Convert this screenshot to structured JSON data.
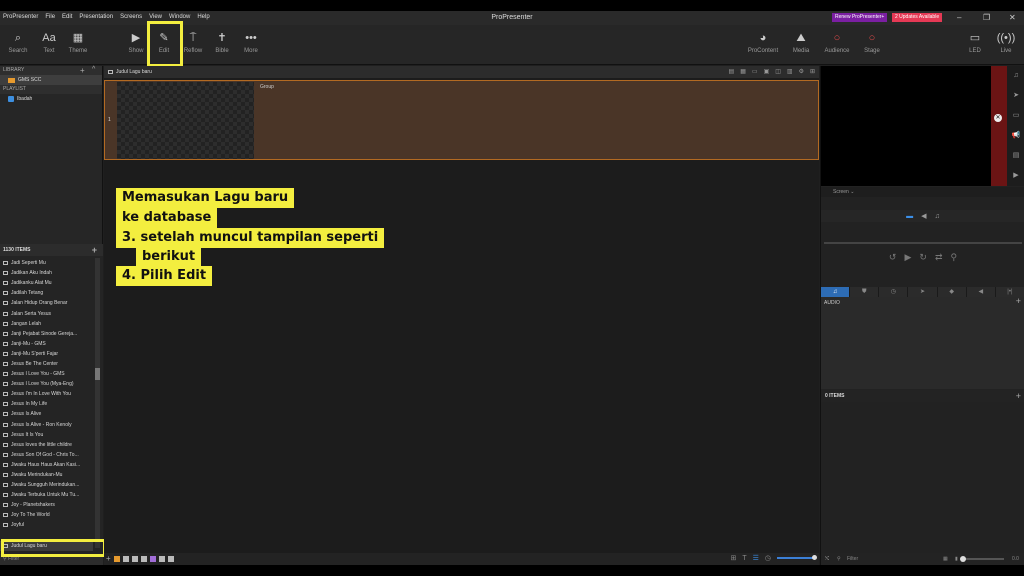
{
  "titlebar": {
    "menu": [
      "ProPresenter",
      "File",
      "Edit",
      "Presentation",
      "Screens",
      "View",
      "Window",
      "Help"
    ],
    "app_title": "ProPresenter",
    "renew_label": "Renew ProPresenter+",
    "updates_label": "2 Updates Available"
  },
  "toolbar": {
    "left": [
      {
        "label": "Search",
        "icon": "search-icon",
        "glyph": "⌕"
      },
      {
        "label": "Text",
        "icon": "text-icon",
        "glyph": "Aa"
      },
      {
        "label": "Theme",
        "icon": "theme-icon",
        "glyph": "▦"
      },
      {
        "label": "Show",
        "icon": "play-icon",
        "glyph": "▶"
      },
      {
        "label": "Edit",
        "icon": "pencil-icon",
        "glyph": "✎"
      },
      {
        "label": "Reflow",
        "icon": "reflow-icon",
        "glyph": "⍑"
      },
      {
        "label": "Bible",
        "icon": "bible-icon",
        "glyph": "✝"
      },
      {
        "label": "More",
        "icon": "more-icon",
        "glyph": "•••"
      }
    ],
    "right": [
      {
        "label": "ProContent",
        "icon": "procontent-icon",
        "glyph": "◕"
      },
      {
        "label": "Media",
        "icon": "media-icon",
        "glyph": "⛰"
      },
      {
        "label": "Audience",
        "icon": "audience-icon",
        "glyph": "○"
      },
      {
        "label": "Stage",
        "icon": "stage-icon",
        "glyph": "○"
      },
      {
        "label": "LED",
        "icon": "led-icon",
        "glyph": "▭"
      },
      {
        "label": "Live",
        "icon": "live-icon",
        "glyph": "((•))"
      }
    ]
  },
  "library": {
    "header": "LIBRARY",
    "items": [
      "GMS SCC"
    ],
    "playlist_header": "PLAYLIST",
    "playlists": [
      "Ibadah"
    ]
  },
  "items_panel": {
    "count_label": "1130 ITEMS",
    "songs": [
      "Jadi Seperti Mu",
      "Jadikan Aku Indah",
      "Jadikanku Alat Mu",
      "Jadilah Tetang",
      "Jalan Hidup Orang Benar",
      "Jalan Serta Yesus",
      "Jangan Lelah",
      "Janji Pejabat Sinode Gereja...",
      "Janji-Mu - GMS",
      "Janji-Mu S'perti Fajar",
      "Jesus Be The Center",
      "Jesus I Love You - GMS",
      "Jesus I Love You (Mya-Eng)",
      "Jesus I'm In Love With You",
      "Jesus In My Life",
      "Jesus Is Alive",
      "Jesus Is Alive - Ron Kenoly",
      "Jesus It Is You",
      "Jesus loves the little childre",
      "Jesus Son Of God - Chris To...",
      "Jiwaku Haus Haus Akan Kasi...",
      "Jiwaku Merindukan-Mu",
      "Jiwaku Sungguh Merindukan...",
      "Jiwaku Terbuka Untuk Mu Tu...",
      "Joy - Planetshakers",
      "Joy To The World",
      "Joyful",
      "Judul Lagu baru"
    ],
    "selected_song": "Judul Lagu baru",
    "filter_placeholder": "Filter"
  },
  "document": {
    "title": "Judul Lagu baru",
    "slide_number": "1",
    "group_label": "Group"
  },
  "annotation": {
    "lines": [
      "Memasukan Lagu baru",
      "ke database",
      "3. setelah muncul tampilan seperti",
      "berikut",
      "4. Pilih Edit"
    ]
  },
  "right_panel": {
    "screen_label": "Screen",
    "audio_header": "AUDIO",
    "items_label": "0 ITEMS",
    "filter_placeholder": "Filter",
    "volume_value": "0.0"
  },
  "colors": {
    "accent_blue": "#3b8fe8",
    "highlight_yellow": "#f3ee3f",
    "slide_bg": "#4a3527",
    "slide_border": "#b36a22",
    "renew_purple": "#7b1fa2",
    "updates_red": "#e53955"
  }
}
